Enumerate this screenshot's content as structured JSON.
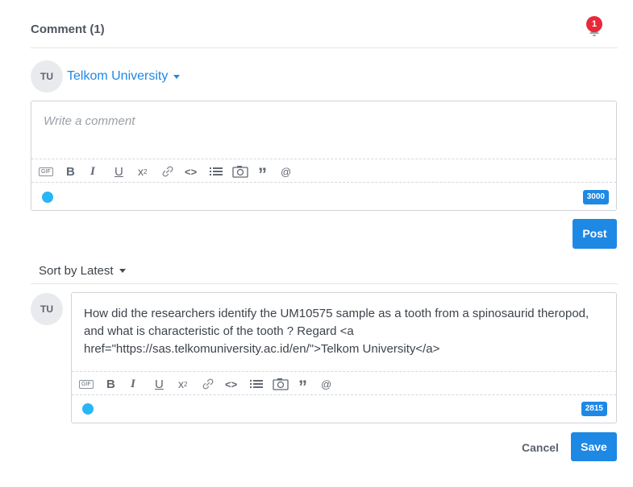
{
  "header": {
    "title": "Comment (1)",
    "notification_count": "1"
  },
  "composer": {
    "avatar_initials": "TU",
    "user_name": "Telkom University",
    "placeholder": "Write a comment",
    "char_count": "3000",
    "post_label": "Post"
  },
  "toolbar": {
    "items": [
      "gif-icon",
      "bold-icon",
      "italic-icon",
      "underline-icon",
      "superscript-icon",
      "link-icon",
      "code-icon",
      "list-icon",
      "camera-icon",
      "quote-icon",
      "mention-icon"
    ],
    "gif_label": "GIF",
    "bold_label": "B",
    "italic_label": "I",
    "underline_label": "U",
    "superscript_label": "x",
    "superscript_sup": "2",
    "code_label": "<>",
    "quote_label": "”",
    "mention_label": "@"
  },
  "sort": {
    "label": "Sort by Latest"
  },
  "comment": {
    "avatar_initials": "TU",
    "text": "How did the researchers identify the UM10575 sample as a tooth from a spinosaurid theropod, and what is characteristic of the tooth ? Regard <a href=\"https://sas.telkomuniversity.ac.id/en/\">Telkom University</a>",
    "char_count": "2815",
    "cancel_label": "Cancel",
    "save_label": "Save"
  },
  "colors": {
    "accent": "#1e88e5",
    "badge": "#e8293a",
    "status_dot": "#29b6f6"
  }
}
